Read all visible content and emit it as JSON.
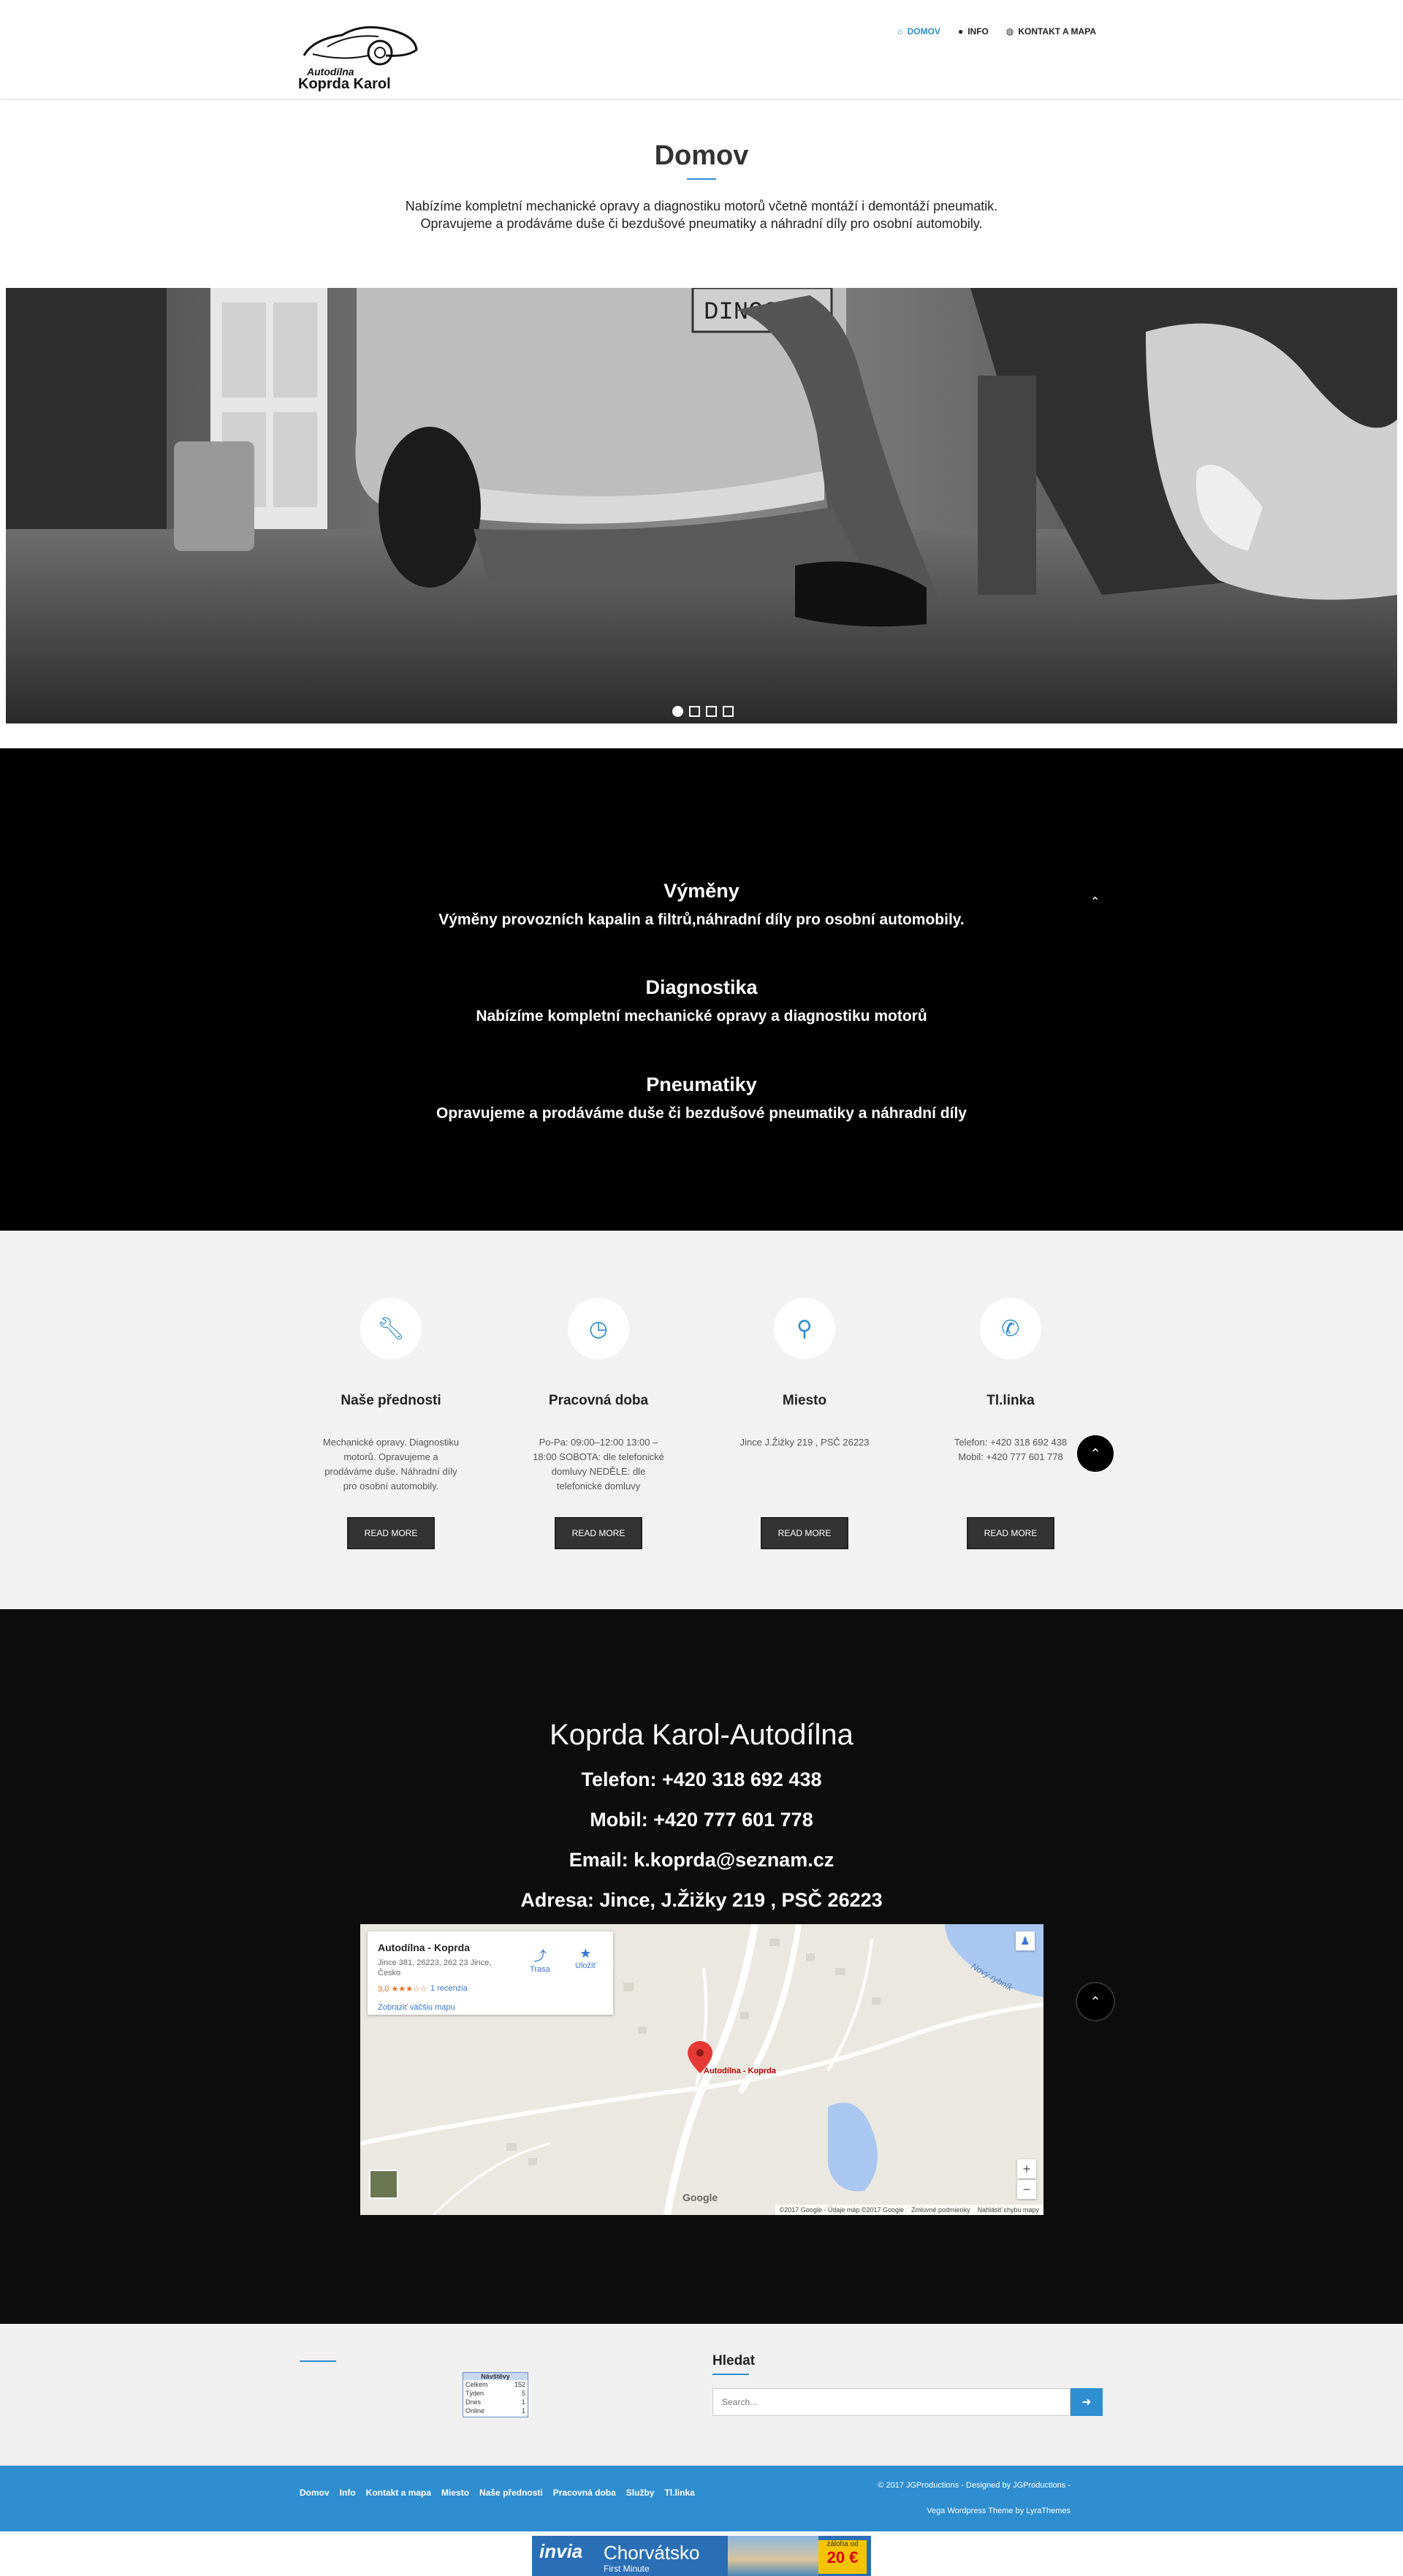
{
  "header": {
    "logo_line1": "Autodílna",
    "logo_line2": "Koprda Karol",
    "nav": [
      {
        "label": "DOMOV",
        "icon": "home-icon",
        "active": true
      },
      {
        "label": "INFO",
        "icon": "user-icon",
        "active": false
      },
      {
        "label": "KONTAKT A MAPA",
        "icon": "globe-icon",
        "active": false
      }
    ]
  },
  "intro": {
    "title": "Domov",
    "line1": "Nabízíme kompletní mechanické opravy a diagnostiku motorů včetně montáží i demontáží pneumatik.",
    "line2": "Opravujeme a prodáváme duše či bezdušové pneumatiky a náhradní díly pro osobní automobily."
  },
  "slider": {
    "plate_text": "DINOCA",
    "dots": [
      true,
      false,
      false,
      false
    ]
  },
  "services": [
    {
      "title": "Výměny",
      "text": "Výměny provozních kapalin a filtrů,náhradní díly pro osobní automobily."
    },
    {
      "title": "Diagnostika",
      "text": "Nabízíme kompletní mechanické opravy a diagnostiku motorů"
    },
    {
      "title": "Pneumatiky",
      "text": "Opravujeme a prodáváme duše či bezdušové pneumatiky a náhradní díly"
    }
  ],
  "features": [
    {
      "icon": "wrench-icon",
      "title": "Naše přednosti",
      "text": "Mechanické opravy. Diagnostiku motorů. Opravujeme a prodáváme duše. Náhradní díly pro osobní automobily.",
      "button": "READ MORE"
    },
    {
      "icon": "clock-icon",
      "title": "Pracovná doba",
      "text": "Po-Pa: 09:00–12:00 13:00 – 18:00 SOBOTA: dle telefonické domluvy NEDĚLE: dle telefonické domluvy",
      "button": "READ MORE"
    },
    {
      "icon": "map-marker-icon",
      "title": "Miesto",
      "text": "Jince J.Žižky 219 , PSČ 26223",
      "button": "READ MORE"
    },
    {
      "icon": "phone-icon",
      "title": "Tl.linka",
      "text": "Telefon: +420 318 692 438 Mobil: +420 777 601 778",
      "button": "READ MORE"
    }
  ],
  "contact": {
    "title": "Koprda Karol-Autodílna",
    "phone": "Telefon: +420 318 692 438",
    "mobile": "Mobil: +420 777 601 778",
    "email": "Email: k.koprda@seznam.cz",
    "address": "Adresa: Jince, J.Žižky 219 , PSČ 26223"
  },
  "map": {
    "place_name": "Autodílna - Koprda",
    "place_address": "Jince 381, 26223, 262 23 Jince, Česko",
    "rating": "3,0 ★★★☆☆",
    "reviews": "1 recenzia",
    "bigger_map": "Zobraziť väčšiu mapu",
    "directions": "Trasa",
    "save": "Uložiť",
    "pin_label": "Autodílna - Koprda",
    "area_label": "Nový rybník",
    "google": "Google",
    "footer_data": "©2017 Google - Údaje máp ©2017 Google",
    "footer_terms": "Zmluvné podmienky",
    "footer_report": "Nahlásiť chybu mapy",
    "zoom_in": "+",
    "zoom_out": "−"
  },
  "widgets": {
    "counter": {
      "head": "Návštěvy",
      "rows": [
        [
          "Celkem",
          "152"
        ],
        [
          "Týden",
          "5"
        ],
        [
          "Dnes",
          "1"
        ],
        [
          "Online",
          "1"
        ]
      ]
    },
    "search_title": "Hledat",
    "search_placeholder": "Search...",
    "search_button_icon": "arrow-right-icon"
  },
  "footer": {
    "nav": [
      "Domov",
      "Info",
      "Kontakt a mapa",
      "Miesto",
      "Naše přednosti",
      "Pracovná doba",
      "Služby",
      "Tl.linka"
    ],
    "copyright": "© 2017 JGProductions - Designed by JGProductions -",
    "theme": "Vega Wordpress Theme by LyraThemes"
  },
  "banner": {
    "brand": "invia",
    "destination": "Chorvátsko",
    "sub": "First Minute",
    "price_prefix": "záloha od",
    "price": "20 €"
  },
  "colors": {
    "accent": "#2f8ed0",
    "dark": "#000000",
    "grey_bg": "#f2f2f2"
  }
}
